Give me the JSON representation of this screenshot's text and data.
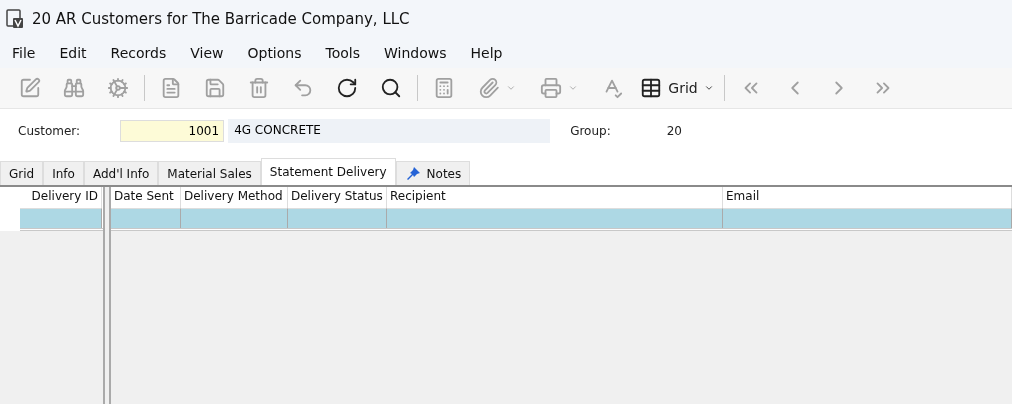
{
  "window": {
    "title": "20 AR Customers for The Barricade Company, LLC"
  },
  "menu": [
    "File",
    "Edit",
    "Records",
    "View",
    "Options",
    "Tools",
    "Windows",
    "Help"
  ],
  "toolbar": [
    {
      "kind": "button",
      "disabled": true
    },
    {
      "kind": "button",
      "disabled": true
    },
    {
      "kind": "button",
      "disabled": true
    },
    {
      "kind": "separator"
    },
    {
      "kind": "button",
      "disabled": true
    },
    {
      "kind": "button",
      "disabled": true
    },
    {
      "kind": "button",
      "disabled": true
    },
    {
      "kind": "button",
      "disabled": true
    },
    {
      "kind": "button",
      "disabled": false
    },
    {
      "kind": "button",
      "disabled": false
    },
    {
      "kind": "separator"
    },
    {
      "kind": "button",
      "disabled": true
    },
    {
      "kind": "dropdown",
      "disabled": true
    },
    {
      "kind": "dropdown",
      "disabled": true
    },
    {
      "kind": "button",
      "disabled": true
    },
    {
      "kind": "view",
      "label": "Grid",
      "disabled": false
    },
    {
      "kind": "separator"
    },
    {
      "kind": "button",
      "disabled": true
    },
    {
      "kind": "button",
      "disabled": true
    },
    {
      "kind": "button",
      "disabled": true
    },
    {
      "kind": "button",
      "disabled": true
    }
  ],
  "header": {
    "customer_label": "Customer:",
    "customer_id": "1001",
    "customer_name": "4G CONCRETE",
    "group_label": "Group:",
    "group_value": "20"
  },
  "tabs": [
    {
      "label": "Grid",
      "selected": false,
      "kind": "plain"
    },
    {
      "label": "Info",
      "selected": false,
      "kind": "plain"
    },
    {
      "label": "Add'l Info",
      "selected": false,
      "kind": "plain"
    },
    {
      "label": "Material Sales",
      "selected": false,
      "kind": "plain"
    },
    {
      "label": "Statement Delivery",
      "selected": true,
      "kind": "plain"
    },
    {
      "label": "Notes",
      "selected": false,
      "kind": "pinned"
    }
  ],
  "left_grid": {
    "columns": [
      "Delivery ID"
    ],
    "rows": [
      {
        "selected": true
      }
    ]
  },
  "right_grid": {
    "columns": [
      "Date Sent",
      "Delivery Method",
      "Delivery Status",
      "Recipient",
      "Email"
    ],
    "rows": [
      {
        "selected": true
      }
    ]
  }
}
